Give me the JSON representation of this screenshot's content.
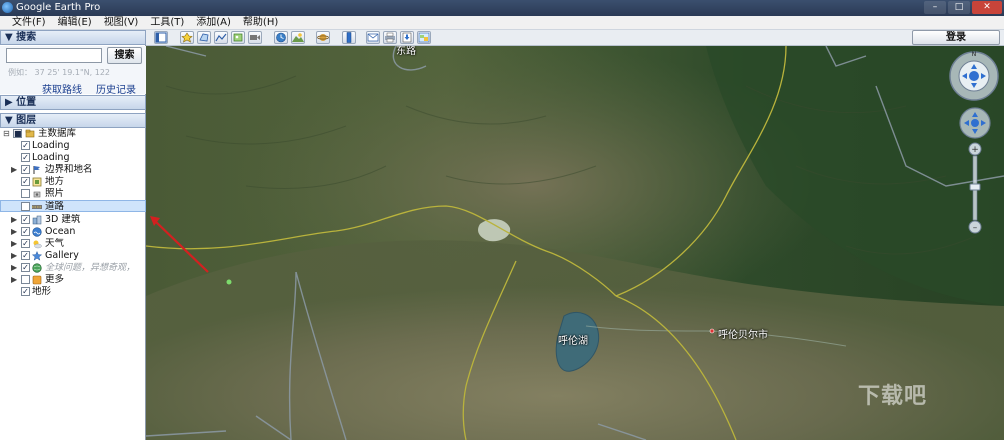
{
  "window": {
    "title": "Google Earth Pro",
    "min": "–",
    "max": "□",
    "close": "✕"
  },
  "menu": [
    {
      "label": "文件(F)"
    },
    {
      "label": "编辑(E)"
    },
    {
      "label": "视图(V)"
    },
    {
      "label": "工具(T)"
    },
    {
      "label": "添加(A)"
    },
    {
      "label": "帮助(H)"
    }
  ],
  "toolbar": {
    "tools": [
      "sidebar-toggle-icon",
      "placemark-icon",
      "polygon-icon",
      "path-icon",
      "image-overlay-icon",
      "record-tour-icon",
      "historical-imagery-icon",
      "sunlight-icon",
      "planets-icon",
      "ruler-icon",
      "email-icon",
      "print-icon",
      "save-image-icon",
      "maps-icon"
    ],
    "login_label": "登录"
  },
  "search": {
    "header": "▼ 搜索",
    "button_label": "搜索",
    "placeholder": "",
    "hint": "例如： 37 25' 19.1\"N, 122",
    "directions_label": "获取路线",
    "history_label": "历史记录"
  },
  "places": {
    "header": "▶ 位置"
  },
  "layers": {
    "header": "▼ 图层",
    "items": [
      {
        "label": "主数据库",
        "checked": "■",
        "icon": "database-icon",
        "expander": "⊟"
      },
      {
        "label": "Loading",
        "checked": "✓",
        "icon": "",
        "expander": ""
      },
      {
        "label": "Loading",
        "checked": "✓",
        "icon": "",
        "expander": ""
      },
      {
        "label": "边界和地名",
        "checked": "✓",
        "icon": "borders-icon",
        "expander": "▶"
      },
      {
        "label": "地方",
        "checked": "✓",
        "icon": "places-icon",
        "expander": ""
      },
      {
        "label": "照片",
        "checked": "",
        "icon": "photos-icon",
        "expander": ""
      },
      {
        "label": "道路",
        "checked": "",
        "icon": "roads-icon",
        "expander": ""
      },
      {
        "label": "3D 建筑",
        "checked": "✓",
        "icon": "buildings-icon",
        "expander": "▶"
      },
      {
        "label": "Ocean",
        "checked": "✓",
        "icon": "ocean-icon",
        "expander": "▶"
      },
      {
        "label": "天气",
        "checked": "✓",
        "icon": "weather-icon",
        "expander": "▶"
      },
      {
        "label": "Gallery",
        "checked": "✓",
        "icon": "gallery-icon",
        "expander": "▶"
      },
      {
        "label": "全球问题，异想奇观，",
        "checked": "✓",
        "icon": "global-icon",
        "expander": "▶"
      },
      {
        "label": "更多",
        "checked": "",
        "icon": "more-icon",
        "expander": "▶"
      },
      {
        "label": "地形",
        "checked": "✓",
        "icon": "",
        "expander": ""
      }
    ]
  },
  "map": {
    "labels": [
      {
        "text": "东路"
      },
      {
        "text": "呼伦湖"
      },
      {
        "text": "呼伦贝尔市"
      }
    ]
  },
  "watermark": "下载吧"
}
